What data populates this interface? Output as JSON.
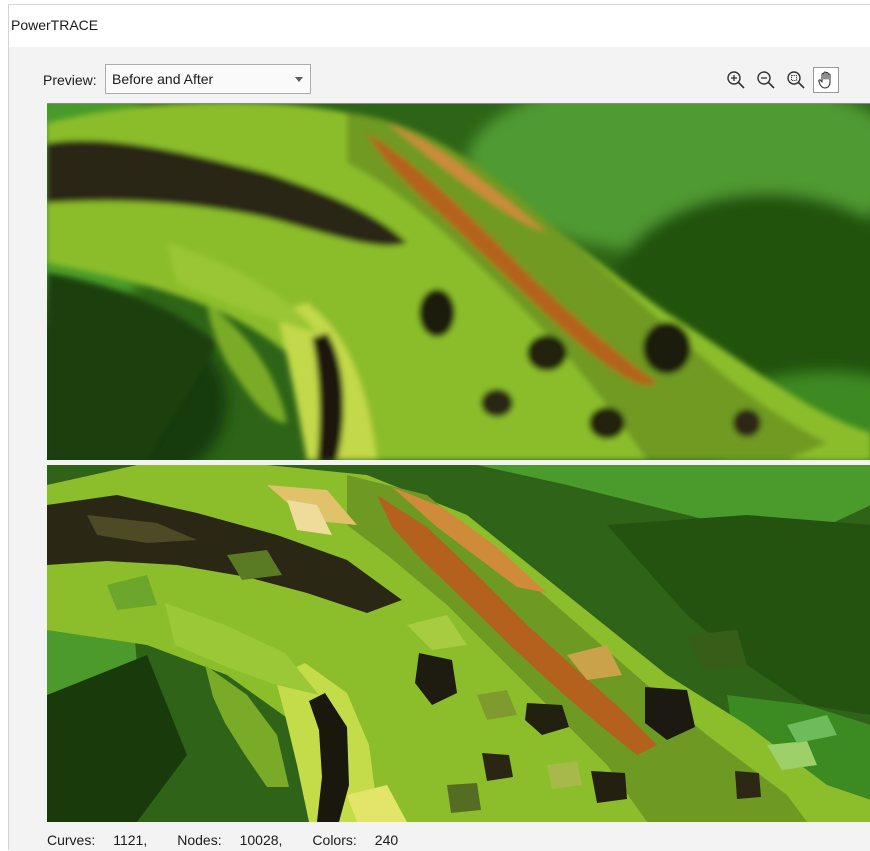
{
  "window": {
    "title": "PowerTRACE"
  },
  "preview": {
    "label": "Preview:",
    "mode": "Before and After"
  },
  "toolbar": {
    "zoom_in": "zoom-in-icon",
    "zoom_out": "zoom-out-icon",
    "zoom_fit": "zoom-fit-icon",
    "pan": "pan-hand-icon",
    "active_tool": "pan"
  },
  "panes": {
    "before": "Original bitmap of a green frog (before tracing)",
    "after": "Traced vector result of the frog (after tracing)"
  },
  "stats": {
    "curves_label": "Curves:",
    "curves_value": "1121,",
    "nodes_label": "Nodes:",
    "nodes_value": "10028,",
    "colors_label": "Colors:",
    "colors_value": "240"
  },
  "colors": {
    "frog_green": "#8fbf2c",
    "frog_dark": "#2a2a14",
    "frog_orange": "#b8641e",
    "background_green": "#3b7a24",
    "dark_green": "#1f3d10"
  }
}
